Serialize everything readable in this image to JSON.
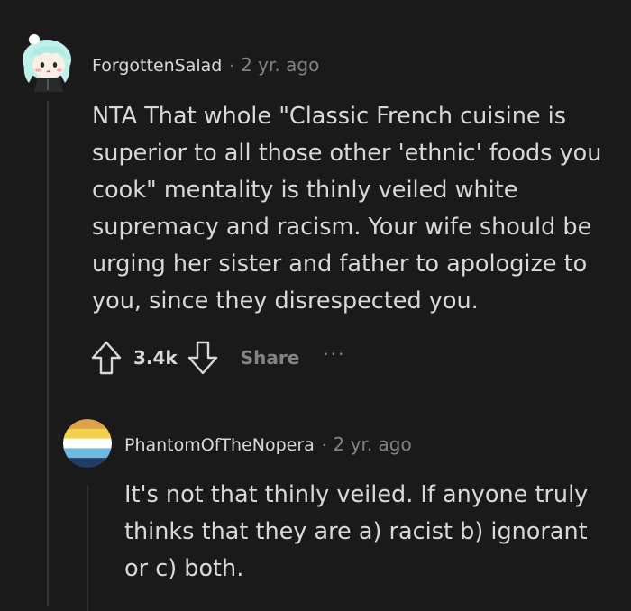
{
  "comment": {
    "username": "ForgottenSalad",
    "separator": "·",
    "age": "2 yr. ago",
    "body": [
      "NTA That whole \"Classic French cuisine is",
      "superior to all those other 'ethnic' foods you",
      "cook\" mentality is thinly veiled white",
      "supremacy and racism. Your wife should be",
      "urging her sister and father to apologize to",
      "you, since they disrespected you."
    ],
    "score": "3.4k",
    "share_label": "Share",
    "more_label": "···"
  },
  "reply": {
    "username": "PhantomOfTheNopera",
    "separator": "·",
    "age": "2 yr. ago",
    "body": [
      "It's not that thinly veiled. If anyone truly",
      "thinks that they are a) racist b) ignorant",
      "or c) both."
    ],
    "flag_colors": [
      "#e1a04a",
      "#f2d24d",
      "#ffffff",
      "#6fb8e0",
      "#213c66"
    ]
  },
  "colors": {
    "background": "#1a1a1b",
    "text": "#d7dadc",
    "muted": "#818384",
    "thread_line": "#343536"
  }
}
